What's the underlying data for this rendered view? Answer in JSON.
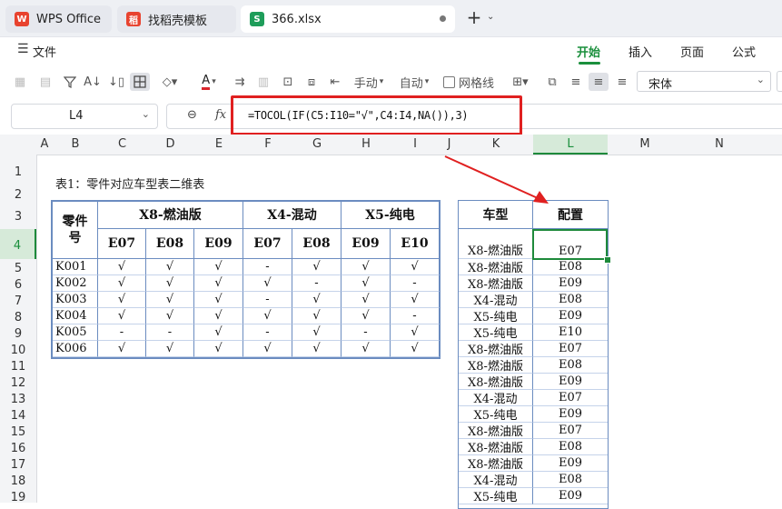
{
  "tabs": [
    {
      "label": "WPS Office",
      "icon": "wps-logo-icon",
      "color": "#e8432f"
    },
    {
      "label": "找稻壳模板",
      "icon": "daoke-logo-icon",
      "color": "#e8432f"
    },
    {
      "label": "366.xlsx",
      "icon": "spreadsheet-icon",
      "color": "#1e9d5a"
    }
  ],
  "menu": {
    "file_label": "文件",
    "tabs": [
      "开始",
      "插入",
      "页面",
      "公式"
    ],
    "active_tab": "开始"
  },
  "toolbar": {
    "manual_label": "手动",
    "auto_label": "自动",
    "gridlines_label": "网格线",
    "font_name": "宋体",
    "font_color": "#d9262c"
  },
  "formula_bar": {
    "cell_ref": "L4",
    "fx_label": "fx",
    "formula": "=TOCOL(IF(C5:I10=\"√\",C4:I4,NA()),3)",
    "highlight_color": "#e02020"
  },
  "columns": [
    "A",
    "B",
    "C",
    "D",
    "E",
    "F",
    "G",
    "H",
    "I",
    "J",
    "K",
    "L",
    "M",
    "N"
  ],
  "rows": [
    "1",
    "2",
    "3",
    "4",
    "5",
    "6",
    "7",
    "8",
    "9",
    "10",
    "11",
    "12",
    "13",
    "14",
    "15",
    "16",
    "17",
    "18",
    "19"
  ],
  "table1": {
    "title": "表1：零件对应车型表二维表",
    "part_header": "零件号",
    "groups": [
      "X8-燃油版",
      "X4-混动",
      "X5-纯电"
    ],
    "codes": [
      "E07",
      "E08",
      "E09",
      "E07",
      "E08",
      "E09",
      "E10"
    ],
    "rows": [
      {
        "part": "K001",
        "vals": [
          "√",
          "√",
          "√",
          "-",
          "√",
          "√",
          "√"
        ]
      },
      {
        "part": "K002",
        "vals": [
          "√",
          "√",
          "√",
          "√",
          "-",
          "√",
          "-"
        ]
      },
      {
        "part": "K003",
        "vals": [
          "√",
          "√",
          "√",
          "-",
          "√",
          "√",
          "√"
        ]
      },
      {
        "part": "K004",
        "vals": [
          "√",
          "√",
          "√",
          "√",
          "√",
          "√",
          "-"
        ]
      },
      {
        "part": "K005",
        "vals": [
          "-",
          "-",
          "√",
          "-",
          "√",
          "-",
          "√"
        ]
      },
      {
        "part": "K006",
        "vals": [
          "√",
          "√",
          "√",
          "√",
          "√",
          "√",
          "√"
        ]
      }
    ]
  },
  "table2": {
    "header_model": "车型",
    "header_config": "配置",
    "rows": [
      [
        "X8-燃油版",
        "E07"
      ],
      [
        "X8-燃油版",
        "E08"
      ],
      [
        "X8-燃油版",
        "E09"
      ],
      [
        "X4-混动",
        "E08"
      ],
      [
        "X5-纯电",
        "E09"
      ],
      [
        "X5-纯电",
        "E10"
      ],
      [
        "X8-燃油版",
        "E07"
      ],
      [
        "X8-燃油版",
        "E08"
      ],
      [
        "X8-燃油版",
        "E09"
      ],
      [
        "X4-混动",
        "E07"
      ],
      [
        "X5-纯电",
        "E09"
      ],
      [
        "X8-燃油版",
        "E07"
      ],
      [
        "X8-燃油版",
        "E08"
      ],
      [
        "X8-燃油版",
        "E09"
      ],
      [
        "X4-混动",
        "E08"
      ],
      [
        "X5-纯电",
        "E09"
      ]
    ]
  },
  "colors": {
    "active_tab_green": "#1a8f3c",
    "selection_green": "#1e8a3b",
    "table_border": "#6b8cc0"
  }
}
